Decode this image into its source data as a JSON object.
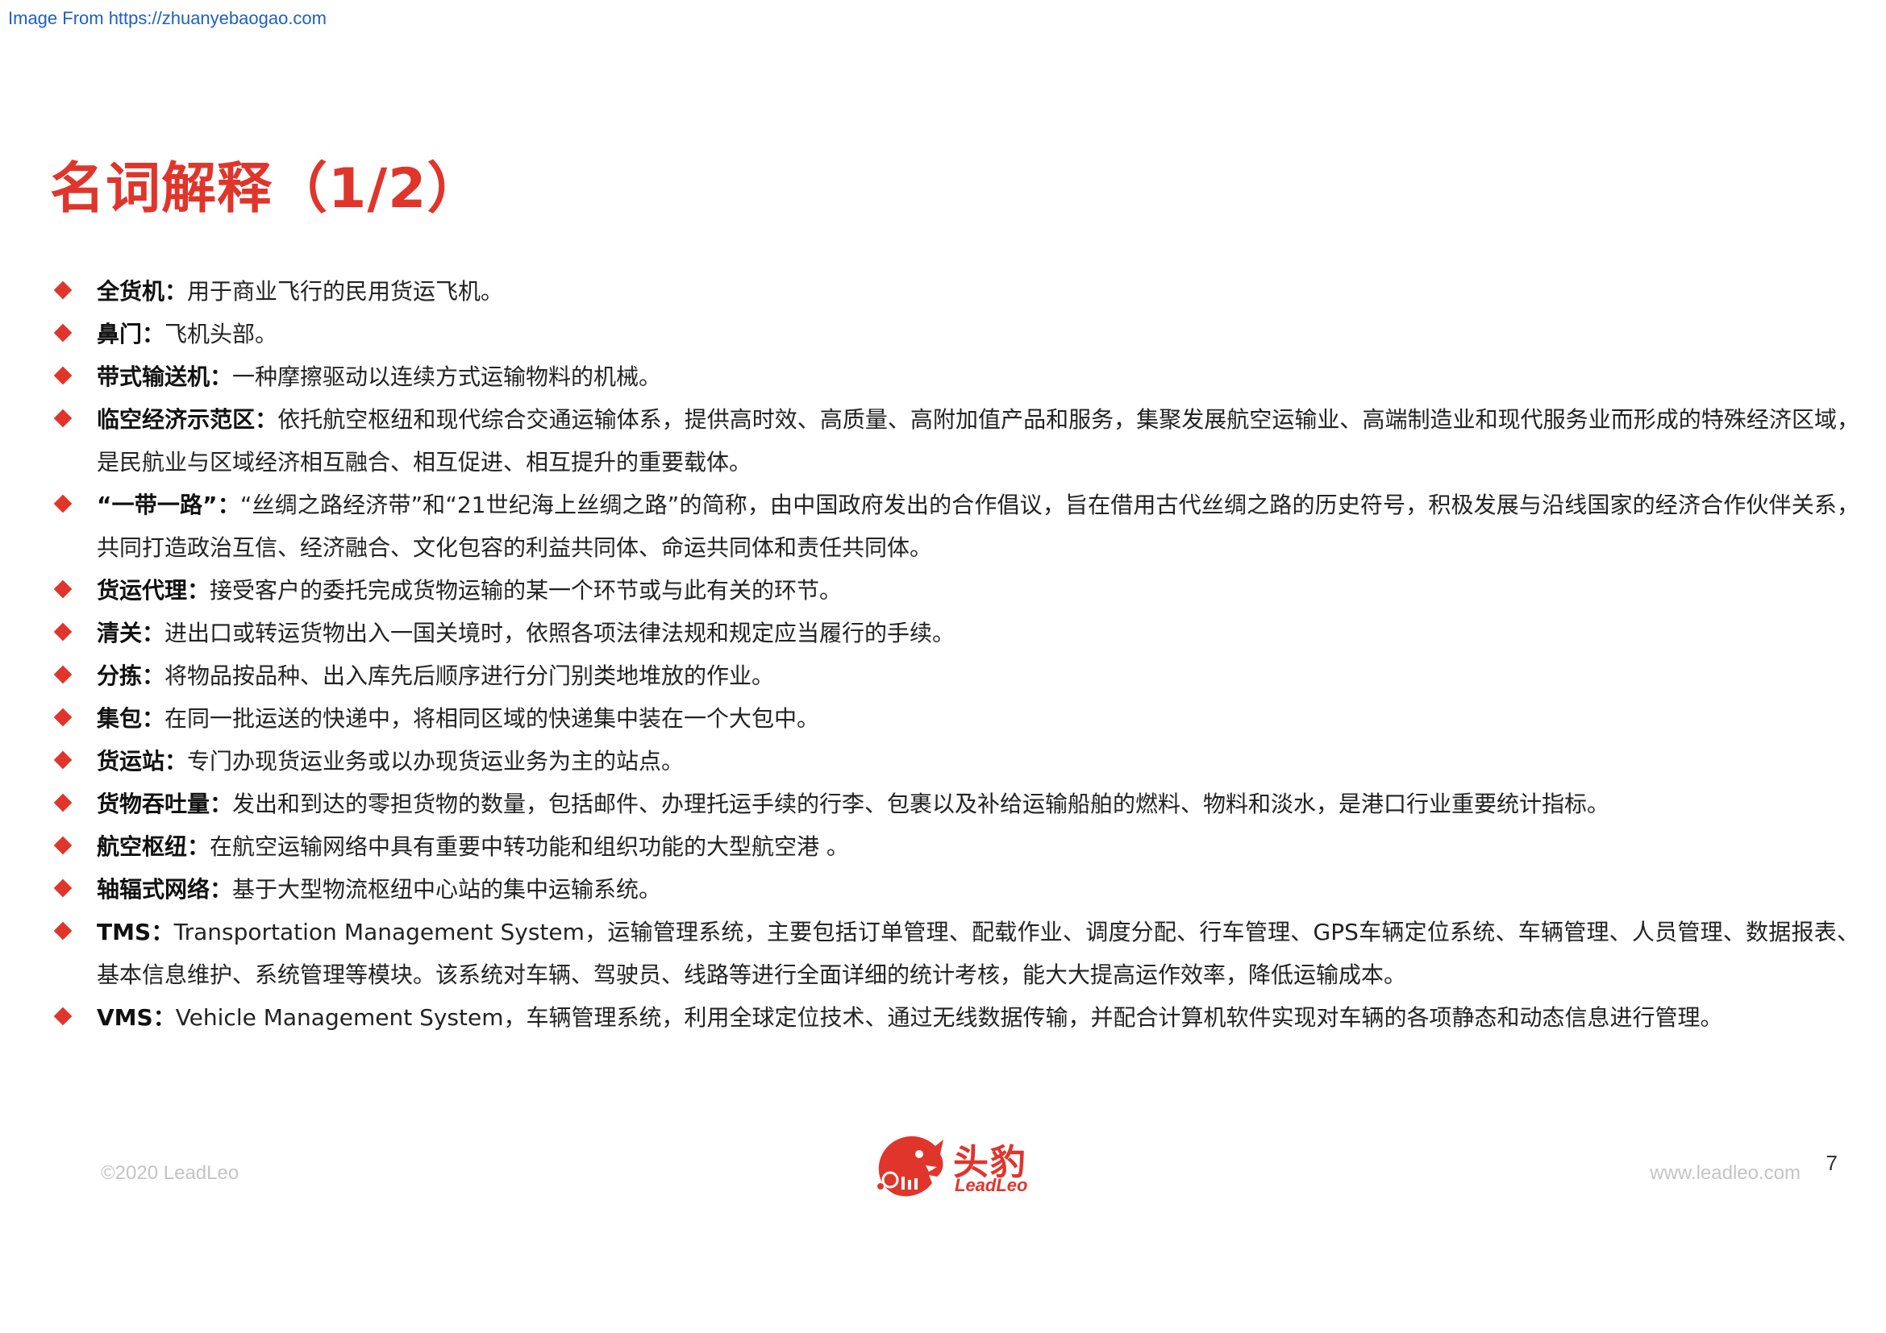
{
  "header": {
    "source": "Image From https://zhuanyebaogao.com"
  },
  "title": "名词解释（1/2）",
  "terms": [
    {
      "term": "全货机：",
      "desc": "用于商业飞行的民用货运飞机。"
    },
    {
      "term": "鼻门：",
      "desc": "飞机头部。"
    },
    {
      "term": "带式输送机：",
      "desc": "一种摩擦驱动以连续方式运输物料的机械。"
    },
    {
      "term": "临空经济示范区：",
      "desc": "依托航空枢纽和现代综合交通运输体系，提供高时效、高质量、高附加值产品和服务，集聚发展航空运输业、高端制造业和现代服务业而形成的特殊经济区域，是民航业与区域经济相互融合、相互促进、相互提升的重要载体。"
    },
    {
      "term": "“一带一路”：",
      "desc": "“丝绸之路经济带”和“21世纪海上丝绸之路”的简称，由中国政府发出的合作倡议，旨在借用古代丝绸之路的历史符号，积极发展与沿线国家的经济合作伙伴关系，共同打造政治互信、经济融合、文化包容的利益共同体、命运共同体和责任共同体。"
    },
    {
      "term": "货运代理：",
      "desc": "接受客户的委托完成货物运输的某一个环节或与此有关的环节。"
    },
    {
      "term": "清关：",
      "desc": "进出口或转运货物出入一国关境时，依照各项法律法规和规定应当履行的手续。"
    },
    {
      "term": "分拣：",
      "desc": "将物品按品种、出入库先后顺序进行分门别类地堆放的作业。"
    },
    {
      "term": "集包：",
      "desc": "在同一批运送的快递中，将相同区域的快递集中装在一个大包中。"
    },
    {
      "term": "货运站：",
      "desc": "专门办现货运业务或以办现货运业务为主的站点。"
    },
    {
      "term": "货物吞吐量：",
      "desc": "发出和到达的零担货物的数量，包括邮件、办理托运手续的行李、包裹以及补给运输船舶的燃料、物料和淡水，是港口行业重要统计指标。"
    },
    {
      "term": "航空枢纽：",
      "desc": "在航空运输网络中具有重要中转功能和组织功能的大型航空港 。"
    },
    {
      "term": "轴辐式网络：",
      "desc": "基于大型物流枢纽中心站的集中运输系统。"
    },
    {
      "term": "TMS：",
      "desc": "Transportation Management System，运输管理系统，主要包括订单管理、配载作业、调度分配、行车管理、GPS车辆定位系统、车辆管理、人员管理、数据报表、基本信息维护、系统管理等模块。该系统对车辆、驾驶员、线路等进行全面详细的统计考核，能大大提高运作效率，降低运输成本。"
    },
    {
      "term": "VMS：",
      "desc": "Vehicle Management System，车辆管理系统，利用全球定位技术、通过无线数据传输，并配合计算机软件实现对车辆的各项静态和动态信息进行管理。"
    }
  ],
  "footer": {
    "copyright": "©2020 LeadLeo",
    "logo_cn": "头豹",
    "logo_en": "LeadLeo",
    "website": "www.leadleo.com",
    "page_number": "7"
  },
  "colors": {
    "accent": "#e0352b",
    "link": "#1f5fbf",
    "footer_text": "#c4c4c4"
  },
  "icons": {
    "bullet": "red-diamond-icon",
    "logo": "leopard-head-logo"
  }
}
